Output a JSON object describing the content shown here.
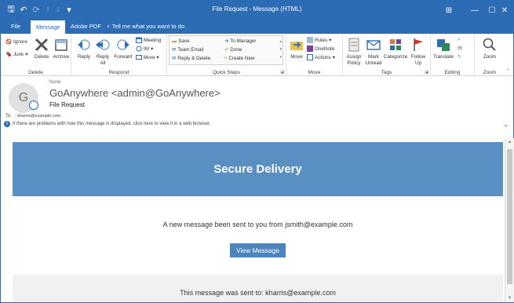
{
  "window": {
    "title": "File Request - Message (HTML)",
    "controls": [
      "⊞",
      "—",
      "☐",
      "✕"
    ]
  },
  "quick_access": [
    "🖫",
    "↶",
    "⟳",
    "↑",
    "↓",
    "▾"
  ],
  "tabs": [
    "File",
    "Message",
    "Adobe PDF"
  ],
  "active_tab": "Message",
  "tell_me": "Tell me what you want to do",
  "ribbon": {
    "delete_group": {
      "label": "Delete",
      "ignore": "Ignore",
      "junk": "Junk",
      "delete": "Delete",
      "archive": "Archive"
    },
    "respond_group": {
      "label": "Respond",
      "reply": "Reply",
      "reply_all": "Reply All",
      "forward": "Forward",
      "meeting": "Meeting",
      "im": "IM",
      "more": "More"
    },
    "quick_steps": {
      "label": "Quick Steps",
      "items": [
        "Save",
        "Team Email",
        "Reply & Delete",
        "To Manager",
        "Done",
        "Create New"
      ]
    },
    "move_group": {
      "label": "Move",
      "move": "Move",
      "rules": "Rules",
      "onenote": "OneNote",
      "actions": "Actions"
    },
    "tags_group": {
      "label": "Tags",
      "assign_policy": "Assign Policy",
      "mark_unread": "Mark Unread",
      "categorize": "Categorize",
      "follow_up": "Follow Up"
    },
    "editing_group": {
      "label": "Editing",
      "translate": "Translate"
    },
    "zoom_group": {
      "label": "Zoom",
      "zoom": "Zoom"
    }
  },
  "message": {
    "flag": "None",
    "avatar_initial": "G",
    "from": "GoAnywhere <admin@GoAnywhere>",
    "subject": "File Request",
    "to_label": "To",
    "to": "kharris@example.com",
    "info_bar": "If there are problems with how this message is displayed, click here to view it in a web browser."
  },
  "body": {
    "banner": "Secure Delivery",
    "text": "A new message been sent to you from jsmith@example.com",
    "button": "View Message",
    "footer": "This message was sent to: kharris@example.com"
  },
  "colors": {
    "accent": "#2b6cb4",
    "banner": "#5a8fc3",
    "button": "#4c85bd"
  }
}
